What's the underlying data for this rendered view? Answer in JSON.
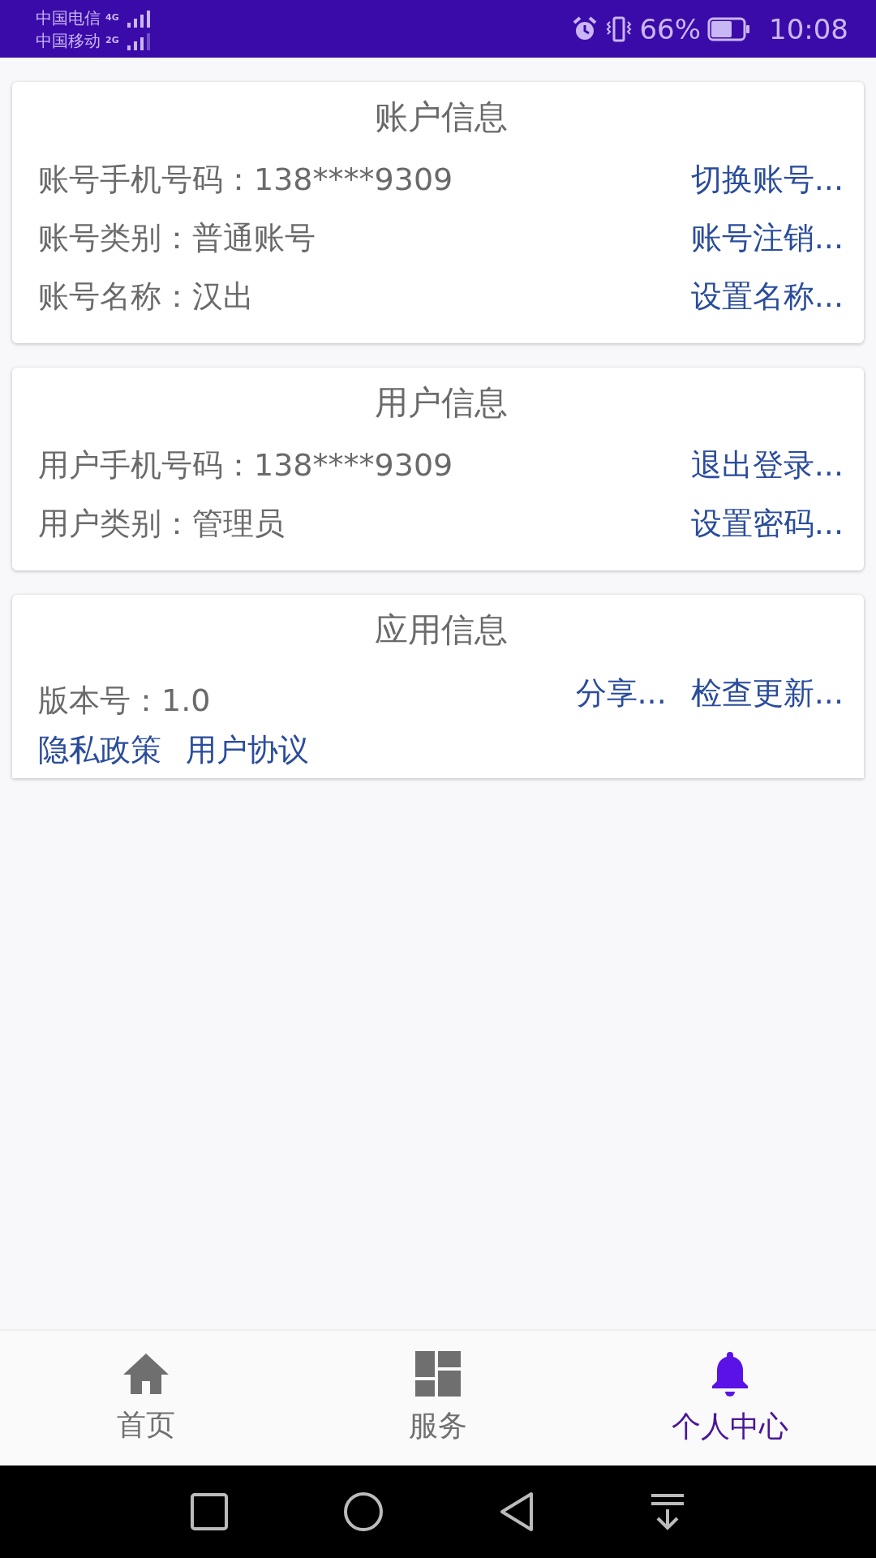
{
  "status_bar": {
    "carriers": [
      {
        "name": "中国电信",
        "network": "4G"
      },
      {
        "name": "中国移动",
        "network": "2G"
      }
    ],
    "battery": "66%",
    "time": "10:08"
  },
  "cards": [
    {
      "kind": "rows",
      "title": "账户信息",
      "rows": [
        {
          "label": "账号手机号码：",
          "value": "138****9309",
          "action": "切换账号..."
        },
        {
          "label": "账号类别：",
          "value": "普通账号",
          "action": "账号注销..."
        },
        {
          "label": "账号名称：",
          "value": "汉出",
          "action": "设置名称..."
        }
      ]
    },
    {
      "kind": "rows",
      "title": "用户信息",
      "rows": [
        {
          "label": "用户手机号码：",
          "value": "138****9309",
          "action": "退出登录..."
        },
        {
          "label": "用户类别：",
          "value": "管理员",
          "action": "设置密码..."
        }
      ]
    },
    {
      "kind": "app",
      "title": "应用信息",
      "version_label": "版本号：",
      "version_value": "1.0",
      "actions": [
        "分享...",
        "检查更新..."
      ],
      "links": [
        "隐私政策",
        "用户协议"
      ]
    }
  ],
  "bottom_nav": [
    {
      "label": "首页",
      "selected": false
    },
    {
      "label": "服务",
      "selected": false
    },
    {
      "label": "个人中心",
      "selected": true
    }
  ]
}
